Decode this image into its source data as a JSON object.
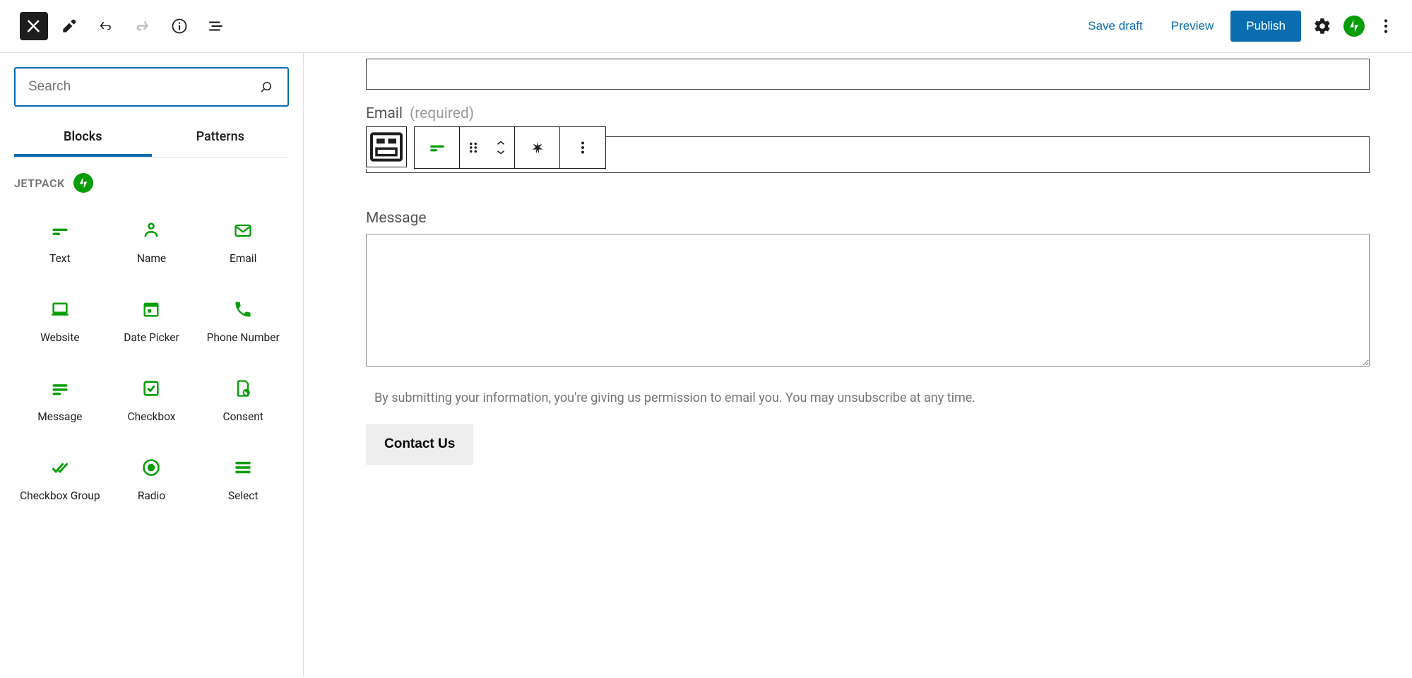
{
  "topbar": {
    "save_draft": "Save draft",
    "preview": "Preview",
    "publish": "Publish"
  },
  "sidebar": {
    "search_placeholder": "Search",
    "tabs": {
      "blocks": "Blocks",
      "patterns": "Patterns"
    },
    "section_title": "JETPACK",
    "blocks": [
      {
        "label": "Text"
      },
      {
        "label": "Name"
      },
      {
        "label": "Email"
      },
      {
        "label": "Website"
      },
      {
        "label": "Date Picker"
      },
      {
        "label": "Phone Number"
      },
      {
        "label": "Message"
      },
      {
        "label": "Checkbox"
      },
      {
        "label": "Consent"
      },
      {
        "label": "Checkbox Group"
      },
      {
        "label": "Radio"
      },
      {
        "label": "Select"
      }
    ]
  },
  "form": {
    "email_label": "Email",
    "email_required": "(required)",
    "message_label": "Message",
    "consent_text": "By submitting your information, you're giving us permission to email you. You may unsubscribe at any time.",
    "submit_label": "Contact Us"
  }
}
